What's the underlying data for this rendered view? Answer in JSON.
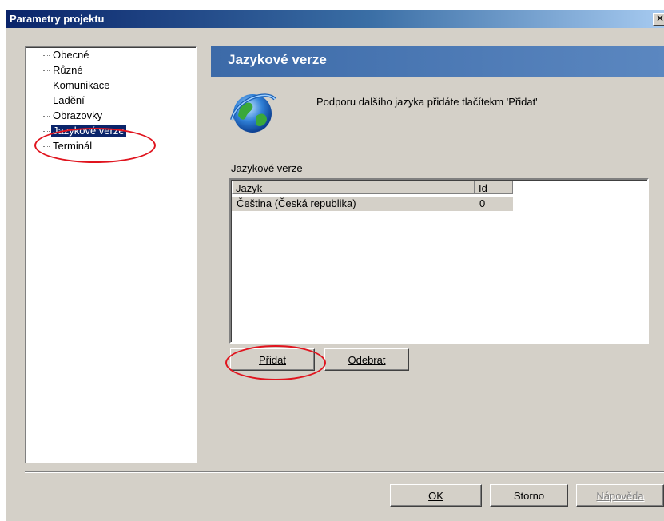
{
  "window": {
    "title": "Parametry projektu",
    "close_glyph": "✕"
  },
  "tree": {
    "items": [
      {
        "label": "Obecné"
      },
      {
        "label": "Různé"
      },
      {
        "label": "Komunikace"
      },
      {
        "label": "Ladění"
      },
      {
        "label": "Obrazovky"
      },
      {
        "label": "Jazykové verze",
        "selected": true
      },
      {
        "label": "Terminál"
      }
    ]
  },
  "panel": {
    "title": "Jazykové verze",
    "info": "Podporu dalšího jazyka přidáte tlačítekm 'Přidat'",
    "group_label": "Jazykové verze",
    "columns": [
      "Jazyk",
      "Id"
    ],
    "rows": [
      {
        "jazyk": "Čeština (Česká republika)",
        "id": "0"
      }
    ],
    "add_label": "Přidat",
    "remove_label": "Odebrat"
  },
  "footer": {
    "ok_label": "OK",
    "cancel_label": "Storno",
    "help_label": "Nápověda"
  },
  "colors": {
    "annotation": "#e0141e",
    "header": "#3c6aa8",
    "selection": "#0a246a"
  },
  "icons": {
    "globe": "globe-icon"
  }
}
